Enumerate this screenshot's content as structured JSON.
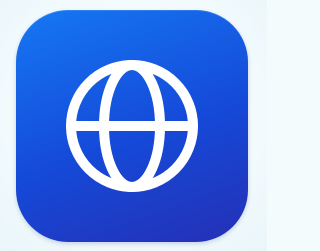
{
  "app_icon": {
    "icon_name": "globe-icon",
    "tile_gradient": [
      "#1578f3",
      "#1549d8",
      "#2530b5"
    ],
    "glyph_color": "#ffffff"
  }
}
